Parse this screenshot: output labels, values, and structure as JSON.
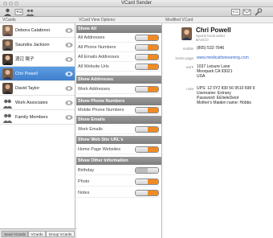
{
  "window": {
    "title": "VCard Sender"
  },
  "panes": {
    "vcards_header": "VCards",
    "options_header": "VCard View Options:",
    "modified_header": "Modified VCard"
  },
  "contacts": [
    {
      "name": "Debora Calabresi",
      "selected": false,
      "avatar": "person-photo"
    },
    {
      "name": "Saundra Jackson",
      "selected": false,
      "avatar": "person-photo"
    },
    {
      "name": "渡辺 陽子",
      "selected": false,
      "avatar": "person-photo"
    },
    {
      "name": "Chri Powell",
      "selected": true,
      "avatar": "person-photo"
    },
    {
      "name": "David Taylor",
      "selected": false,
      "avatar": "person-photo"
    },
    {
      "name": "Work Associates",
      "selected": false,
      "avatar": "group-icon"
    },
    {
      "name": "Family Members",
      "selected": false,
      "avatar": "group-icon"
    }
  ],
  "bottom_tabs": [
    "Send VCards",
    "VCards",
    "Group VCards"
  ],
  "options": {
    "show_all": {
      "header": "Show All",
      "items": [
        {
          "label": "All Addresses",
          "on": true
        },
        {
          "label": "All Phone Numbers",
          "on": true
        },
        {
          "label": "All Emails Addresses",
          "on": true
        },
        {
          "label": "All Website Urls",
          "on": true
        }
      ]
    },
    "show_addresses": {
      "header": "Show Addresses",
      "items": [
        {
          "label": "Work Addresses",
          "on": true
        }
      ]
    },
    "show_phone": {
      "header": "Show Phone Numbers",
      "items": [
        {
          "label": "Mobile Phone Numbers",
          "on": true
        }
      ]
    },
    "show_emails": {
      "header": "Show Emails",
      "items": [
        {
          "label": "Work Emails",
          "on": true
        }
      ]
    },
    "show_web": {
      "header": "Show Web Site URL's",
      "items": [
        {
          "label": "Home Page Websites",
          "on": true
        }
      ]
    },
    "show_other": {
      "header": "Show Other Information",
      "items": [
        {
          "label": "Birthday",
          "on": false
        },
        {
          "label": "Photo",
          "on": true
        },
        {
          "label": "Notes",
          "on": true
        }
      ]
    }
  },
  "card": {
    "name": "Chri Powell",
    "title": "Sports book writer",
    "company": "BASCO",
    "mobile_label": "mobile",
    "mobile": "(805) 532-7646",
    "homepage_label": "home page",
    "homepage": "www.medicatloniearning.com",
    "work_label": "work",
    "address_lines": [
      "1037 Leisure Lane",
      "Moorpark CA 93021",
      "USA"
    ],
    "note_label": "note",
    "note_lines": [
      "UPS: 1Z 0Y2 830 56 9510 698 9",
      "Username: Extrany",
      "Password: EEtieleDeiot",
      "Mother's Maiden name: Hobbs"
    ]
  },
  "colors": {
    "toggle_on": "#f08a24",
    "toggle_off": "#bdbdbd",
    "selection": "#3f7fcd",
    "section": "#8a8a8a"
  }
}
